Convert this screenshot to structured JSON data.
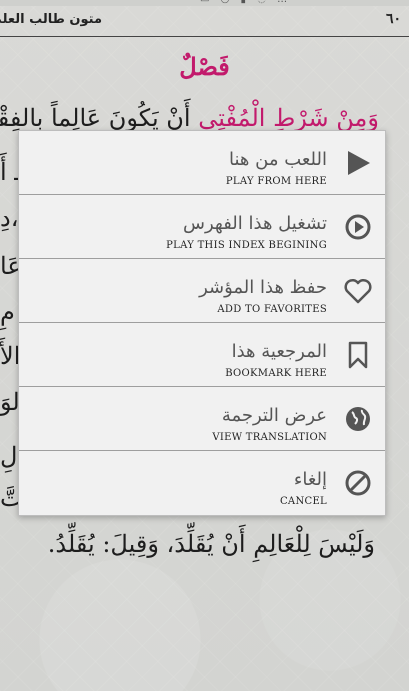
{
  "book": {
    "title": "متون طالب العلم",
    "page_number": "٦٠"
  },
  "content": {
    "chapter_title": "فَصْلٌ",
    "line_1_highlight": "وَمِنْ شَرْطِ الْمُفْتِي",
    "line_1_rest": "أَنْ يَكُونَ عَالِماً بِالفِقْهِ",
    "line_last": "وَلَيْسَ لِلْعَالِمِ أَنْ يُقَلِّدَ، وَقِيلَ: يُقَلِّدُ.",
    "left_edge_fragments": [
      "ـ أَ",
      "دِ،",
      "عَا",
      "ـ مِ",
      "الأَ",
      "الوَ",
      "لِ",
      "التَّ"
    ]
  },
  "menu": {
    "items": [
      {
        "label_ar": "اللعب من هنا",
        "label_en": "PLAY FROM HERE",
        "icon": "play-icon"
      },
      {
        "label_ar": "تشغيل هذا الفهرس",
        "label_en": "PLAY THIS INDEX BEGINING",
        "icon": "play-circle-icon"
      },
      {
        "label_ar": "حفظ هذا المؤشر",
        "label_en": "ADD TO FAVORITES",
        "icon": "heart-icon"
      },
      {
        "label_ar": "المرجعية هذا",
        "label_en": "BOOKMARK HERE",
        "icon": "bookmark-icon"
      },
      {
        "label_ar": "عرض الترجمة",
        "label_en": "VIEW TRANSLATION",
        "icon": "globe-icon"
      },
      {
        "label_ar": "إلغاء",
        "label_en": "CANCEL",
        "icon": "cancel-icon"
      }
    ]
  },
  "colors": {
    "accent": "#c21a6c",
    "menu_background": "#f1f1f1",
    "icon": "#555555"
  }
}
